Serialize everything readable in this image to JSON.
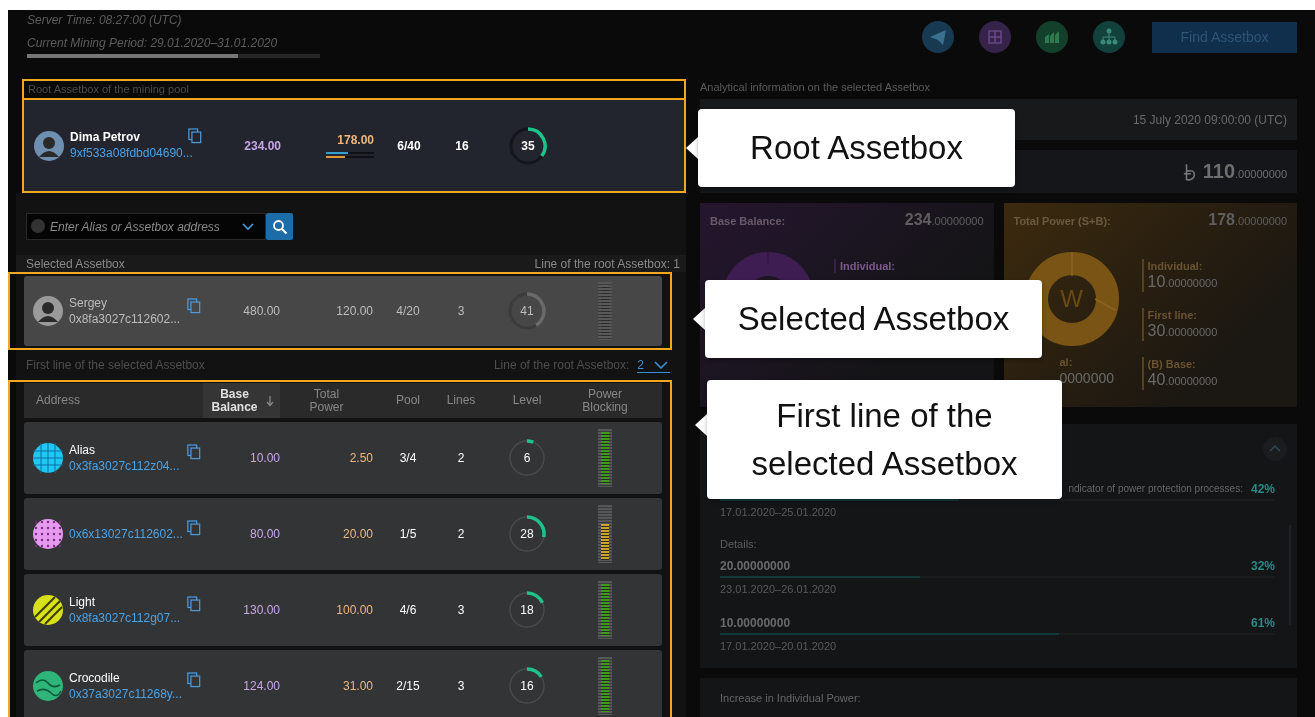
{
  "header": {
    "server_time": "Server Time: 08:27:00 (UTC)",
    "mining_period": "Current Mining Period: 29.01.2020–31.01.2020",
    "period_progress": {
      "level": 0.72
    }
  },
  "toolbar": {
    "find_button": "Find Assetbox"
  },
  "root": {
    "title": "Root Assetbox of the mining pool",
    "highlighted": true,
    "card": {
      "name": "Dima Petrov",
      "address": "9xf533a08fdbd04690...",
      "avatar": {
        "kind": "person",
        "color": "#6f8fb0"
      },
      "base_balance": "234.00",
      "total_power": "178.00",
      "power_bars": [
        {
          "color": "#2f9fd0",
          "level": 0.45
        },
        {
          "color": "#e09a3a",
          "level": 0.4
        }
      ],
      "pool": "6/40",
      "lines": "16",
      "ring": {
        "label": "35"
      }
    }
  },
  "search": {
    "placeholder": "Enter Alias or Assetbox address"
  },
  "selected": {
    "title": "Selected Assetbox",
    "line_label": "Line of the root Assetbox: 1",
    "highlighted": true,
    "card": {
      "name": "Sergey",
      "address": "0x8fa3027c112602...",
      "avatar": {
        "kind": "person",
        "color": "#9a9a9a"
      },
      "base_balance": "480.00",
      "total_power": "120.00",
      "pool": "4/20",
      "lines": "3",
      "ring": {
        "label": "41"
      },
      "blocking": {
        "color": "#5a5a5a",
        "level": 1
      }
    }
  },
  "first_line": {
    "title": "First line of the selected Assetbox",
    "line_label": "Line of the root Assetbox:",
    "line_value": "2",
    "highlighted": true,
    "columns": [
      {
        "label": "Address",
        "sorted": false
      },
      {
        "label": "Base Balance",
        "sorted": true
      },
      {
        "label": "Total Power",
        "sorted": false
      },
      {
        "label": "Pool",
        "sorted": false
      },
      {
        "label": "Lines",
        "sorted": false
      },
      {
        "label": "Level",
        "sorted": false
      },
      {
        "label": "Power Blocking",
        "sorted": false
      }
    ],
    "rows": [
      {
        "name": "Alias",
        "address": "0x3fa3027c112z04...",
        "avatar": {
          "kind": "grid",
          "color": "#1ec8f0"
        },
        "base_balance": "10.00",
        "total_power": "2.50",
        "pool": "3/4",
        "lines": "2",
        "ring": {
          "label": "6"
        },
        "blocking": {
          "color": "#3f9a1e",
          "level": 1
        }
      },
      {
        "address": "0x6x13027c112602...",
        "avatar": {
          "kind": "dots",
          "color": "#e59af0"
        },
        "base_balance": "80.00",
        "total_power": "20.00",
        "pool": "1/5",
        "lines": "2",
        "ring": {
          "label": "28"
        },
        "blocking": {
          "color": "#c9a230",
          "level": 0.7
        }
      },
      {
        "name": "Light",
        "address": "0x8fa3027c112g07...",
        "avatar": {
          "kind": "stripes",
          "color": "#d8e01a"
        },
        "base_balance": "130.00",
        "total_power": "100.00",
        "pool": "4/6",
        "lines": "3",
        "ring": {
          "label": "18"
        },
        "blocking": {
          "color": "#3f9a1e",
          "level": 1
        }
      },
      {
        "name": "Crocodile",
        "address": "0x37a3027c11268y...",
        "avatar": {
          "kind": "blob",
          "color": "#2fb57a"
        },
        "base_balance": "124.00",
        "total_power": "31.00",
        "pool": "2/15",
        "lines": "3",
        "ring": {
          "label": "16"
        },
        "blocking": {
          "color": "#3f9a1e",
          "level": 1
        }
      }
    ]
  },
  "analytics": {
    "title": "Analytical information on the selected Assetbox",
    "date": "15 July 2020 09:00:00 (UTC)",
    "balance": {
      "int": "110",
      "frac": ".00000000"
    },
    "base_card": {
      "label": "Base Balance:",
      "int": "234",
      "frac": ".00000000",
      "legend": [
        {
          "label": "Individual:"
        }
      ]
    },
    "power_card": {
      "label": "Total Power (S+B):",
      "int": "178",
      "frac": ".00000000",
      "donut_label": "W",
      "partial_label": "al:",
      "partial_value": "0000000",
      "legend": [
        {
          "label": "Individual:",
          "int": "10",
          "frac": ".00000000"
        },
        {
          "label": "First line:",
          "int": "30",
          "frac": ".00000000"
        },
        {
          "label": "(B) Base:",
          "int": "40",
          "frac": ".00000000"
        }
      ]
    },
    "indicator": {
      "label": "ndicator of power protection processes:",
      "percent": "42%",
      "level": 0.43,
      "period": "17.01.2020–25.01.2020",
      "details_label": "Details:",
      "details": [
        {
          "amount": "20.00000000",
          "percent": "32%",
          "level": 0.36,
          "period": "23.01.2020–26.01.2020"
        },
        {
          "amount": "10.00000000",
          "percent": "61%",
          "level": 0.61,
          "period": "17.01.2020–20.01.2020"
        }
      ]
    },
    "increase_title": "Increase in Individual Power:"
  },
  "callouts": [
    {
      "kind": "root",
      "lines": [
        "Root Assetbox"
      ]
    },
    {
      "kind": "selected",
      "lines": [
        "Selected Assetbox"
      ]
    },
    {
      "kind": "first",
      "lines": [
        "First line of the",
        "selected Assetbox"
      ]
    }
  ]
}
